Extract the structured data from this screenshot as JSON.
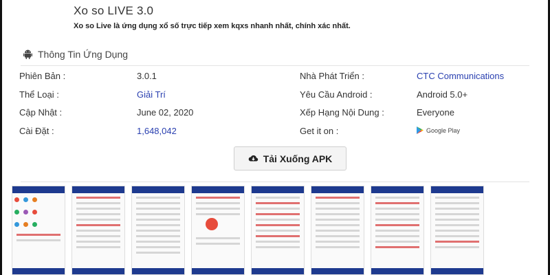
{
  "app": {
    "title": "Xo so LIVE 3.0",
    "description": "Xo so Live là ứng dụng xổ số trực tiếp xem kqxs nhanh nhất, chính xác nhất."
  },
  "section": {
    "title": "Thông Tin Ứng Dụng",
    "icon": "android-icon"
  },
  "info": {
    "version_label": "Phiên Bản :",
    "version_value": "3.0.1",
    "category_label": "Thể Loại :",
    "category_value": "Giải Trí",
    "updated_label": "Cập Nhật :",
    "updated_value": "June 02, 2020",
    "installs_label": "Cài Đặt :",
    "installs_value": "1,648,042",
    "developer_label": "Nhà Phát Triển :",
    "developer_value": "CTC Communications",
    "android_label": "Yêu Cầu Android :",
    "android_value": "Android 5.0+",
    "rating_label": "Xếp Hạng Nội Dung :",
    "rating_value": "Everyone",
    "getit_label": "Get it on :",
    "getit_value": "Google Play"
  },
  "download": {
    "label": "Tải Xuống APK",
    "icon": "cloud-download-icon"
  },
  "colors": {
    "link": "#2a40b0",
    "screenshot_header": "#1e3a8f"
  },
  "screenshots_count": 8
}
